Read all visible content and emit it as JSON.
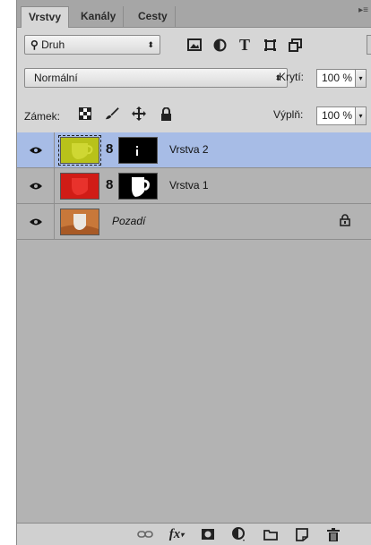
{
  "tabs": [
    {
      "label": "Vrstvy",
      "active": true
    },
    {
      "label": "Kanály",
      "active": false
    },
    {
      "label": "Cesty",
      "active": false
    }
  ],
  "filter": {
    "kind_label": "Druh"
  },
  "blend": {
    "mode": "Normální"
  },
  "opacity": {
    "label": "Krytí:",
    "value": "100 %"
  },
  "lock": {
    "label": "Zámek:"
  },
  "fill": {
    "label": "Výplň:",
    "value": "100 %"
  },
  "layers": [
    {
      "name": "Vrstva 2",
      "selected": true,
      "visible": true,
      "thumb_color": "#b8c21a"
    },
    {
      "name": "Vrstva 1",
      "selected": false,
      "visible": true,
      "thumb_color": "#d01c16"
    },
    {
      "name": "Pozadí",
      "selected": false,
      "visible": true,
      "locked": true,
      "thumb_color": "#c8783a"
    }
  ],
  "colors": {
    "panel": "#b3b3b3",
    "selection": "#a7bce6",
    "toolbar": "#d6d6d6"
  }
}
